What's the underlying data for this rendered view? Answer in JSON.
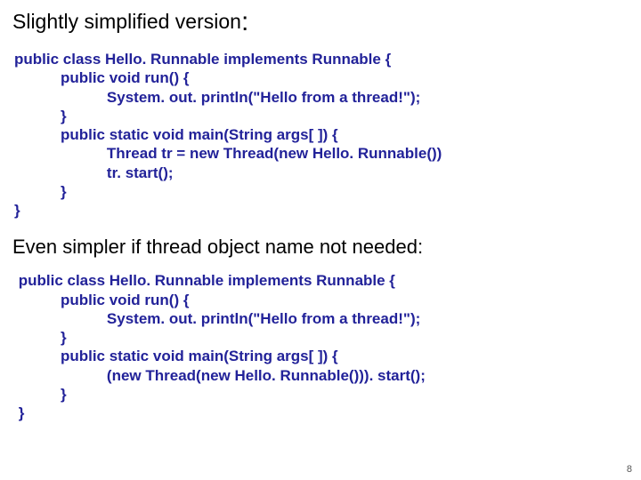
{
  "heading1_text": "Slightly simplified version",
  "heading1_colon": ":",
  "code1": "public class Hello. Runnable implements Runnable {\n           public void run() {\n                      System. out. println(\"Hello from a thread!\");\n           }\n           public static void main(String args[ ]) {\n                      Thread tr = new Thread(new Hello. Runnable())\n                      tr. start();\n           }\n}",
  "heading2": "Even simpler if thread object name not needed:",
  "code2": " public class Hello. Runnable implements Runnable {\n           public void run() {\n                      System. out. println(\"Hello from a thread!\");\n           }\n           public static void main(String args[ ]) {\n                      (new Thread(new Hello. Runnable())). start();\n           }\n }",
  "page_number": "8"
}
